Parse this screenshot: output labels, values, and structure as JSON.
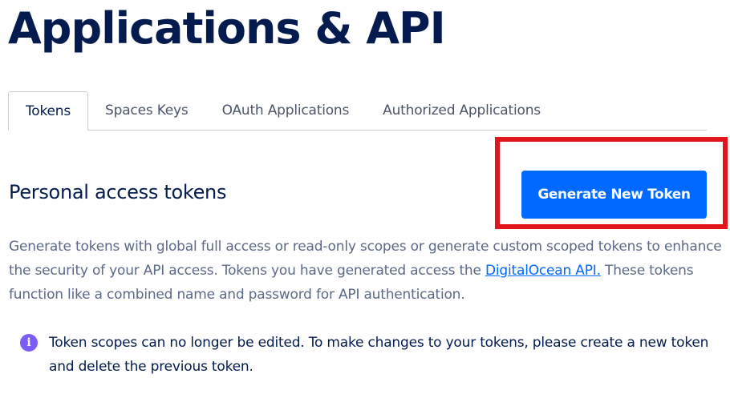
{
  "page": {
    "title": "Applications & API"
  },
  "tabs": [
    {
      "label": "Tokens",
      "active": true
    },
    {
      "label": "Spaces Keys",
      "active": false
    },
    {
      "label": "OAuth Applications",
      "active": false
    },
    {
      "label": "Authorized Applications",
      "active": false
    }
  ],
  "tokens_section": {
    "title": "Personal access tokens",
    "generate_button_label": "Generate New Token",
    "description_before_link": "Generate tokens with global full access or read-only scopes or generate custom scoped tokens to enhance the security of your API access. Tokens you have generated access the ",
    "description_link_text": "DigitalOcean API.",
    "description_after_link": " These tokens function like a combined name and password for API authentication.",
    "notice_text": "Token scopes can no longer be edited. To make changes to your tokens, please create a new token and delete the previous token.",
    "notice_icon": "info-icon"
  },
  "colors": {
    "heading": "#031b4e",
    "primary_button": "#0069ff",
    "highlight_border": "#e3161b",
    "body_text": "#5b6987",
    "info_icon": "#7b5cf5"
  }
}
